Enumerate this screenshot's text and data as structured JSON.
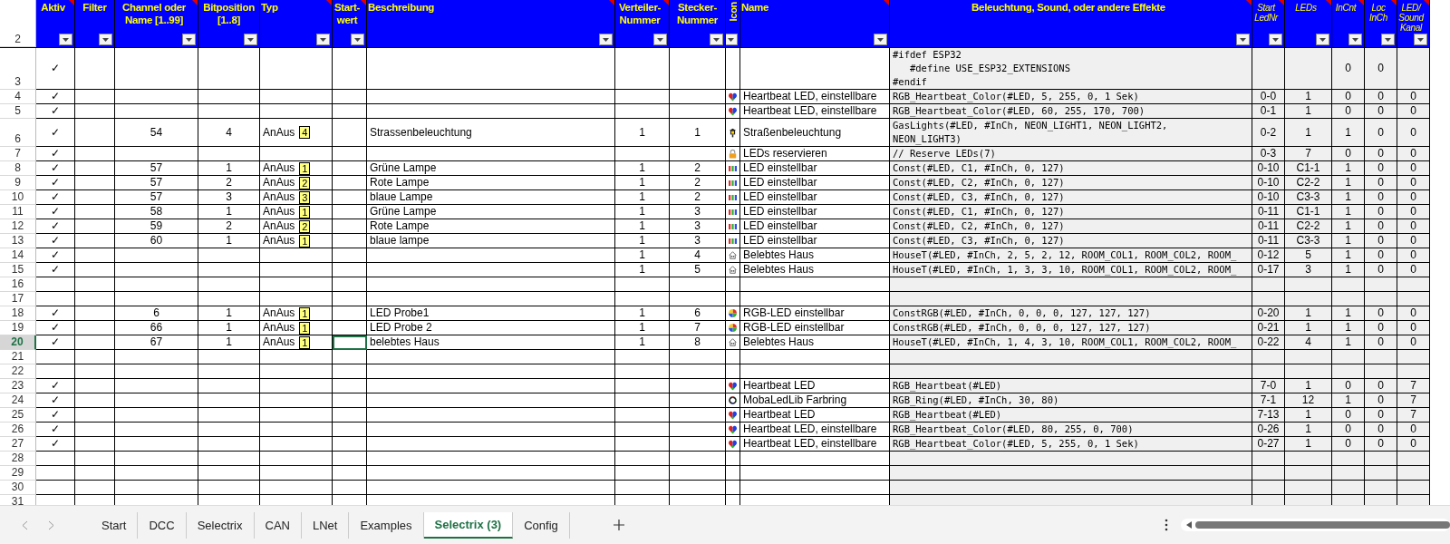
{
  "header_row": "2",
  "columns": [
    {
      "label": "Aktiv",
      "kind": "main",
      "comment": true
    },
    {
      "label": "Filter",
      "kind": "main",
      "comment": false
    },
    {
      "label": "Channel oder Name [1..99]",
      "kind": "main",
      "comment": true
    },
    {
      "label": "Bitposition [1..8]",
      "kind": "main",
      "comment": false
    },
    {
      "label": "Typ",
      "kind": "main",
      "comment": true
    },
    {
      "label": "Start-wert",
      "kind": "main",
      "comment": true
    },
    {
      "label": "Beschreibung",
      "kind": "main",
      "comment": true
    },
    {
      "label": "Verteiler-Nummer",
      "kind": "main",
      "comment": true
    },
    {
      "label": "Stecker-Nummer",
      "kind": "main",
      "comment": false
    },
    {
      "label": "Icon",
      "kind": "vertical",
      "comment": false
    },
    {
      "label": "Name",
      "kind": "main",
      "comment": true
    },
    {
      "label": "Beleuchtung, Sound, oder andere Effekte",
      "kind": "main",
      "comment": true
    },
    {
      "label": "Start LedNr",
      "kind": "small",
      "comment": true
    },
    {
      "label": "LEDs",
      "kind": "small",
      "comment": true
    },
    {
      "label": "InCnt",
      "kind": "small",
      "comment": true
    },
    {
      "label": "Loc InCh",
      "kind": "small",
      "comment": true
    },
    {
      "label": "LED/ Sound Kanal",
      "kind": "small",
      "comment": true
    }
  ],
  "rows": [
    {
      "n": "3",
      "selected": false,
      "aktiv": "✓",
      "effect": "#ifdef ESP32\n   #define USE_ESP32_EXTENSIONS\n#endif",
      "incnt": "0",
      "loc": "0"
    },
    {
      "n": "4",
      "selected": false,
      "aktiv": "✓",
      "kind": "heart",
      "name": "Heartbeat LED, einstellbare",
      "effect": "RGB_Heartbeat_Color(#LED, 5, 255, 0, 1 Sek)",
      "start": "0-0",
      "leds": "1",
      "incnt": "0",
      "loc": "0",
      "kanal": "0"
    },
    {
      "n": "5",
      "selected": false,
      "aktiv": "✓",
      "kind": "heart",
      "name": "Heartbeat LED, einstellbare",
      "effect": "RGB_Heartbeat_Color(#LED, 60, 255, 170, 700)",
      "start": "0-1",
      "leds": "1",
      "incnt": "0",
      "loc": "0",
      "kanal": "0"
    },
    {
      "n": "6",
      "selected": false,
      "aktiv": "✓",
      "channel": "54",
      "bitpos": "4",
      "typ": "AnAus",
      "badge": "4",
      "desc": "Strassenbeleuchtung",
      "verteiler": "1",
      "stecker": "1",
      "kind": "lantern",
      "name": "Straßenbeleuchtung",
      "effect": "GasLights(#LED, #InCh, NEON_LIGHT1, NEON_LIGHT2,\nNEON_LIGHT3)",
      "start": "0-2",
      "leds": "1",
      "incnt": "1",
      "loc": "0",
      "kanal": "0"
    },
    {
      "n": "7",
      "selected": false,
      "aktiv": "✓",
      "kind": "lock",
      "name": "LEDs reservieren",
      "effect": "// Reserve LEDs(7)",
      "start": "0-3",
      "leds": "7",
      "incnt": "0",
      "loc": "0",
      "kanal": "0"
    },
    {
      "n": "8",
      "selected": false,
      "aktiv": "✓",
      "channel": "57",
      "bitpos": "1",
      "typ": "AnAus",
      "badge": "1",
      "desc": "Grüne Lampe",
      "verteiler": "1",
      "stecker": "2",
      "kind": "leds",
      "name": "LED einstellbar",
      "effect": "Const(#LED, C1, #InCh, 0, 127)",
      "start": "0-10",
      "leds": "C1-1",
      "incnt": "1",
      "loc": "0",
      "kanal": "0"
    },
    {
      "n": "9",
      "selected": false,
      "aktiv": "✓",
      "channel": "57",
      "bitpos": "2",
      "typ": "AnAus",
      "badge": "2",
      "desc": "Rote Lampe",
      "verteiler": "1",
      "stecker": "2",
      "kind": "leds",
      "name": "LED einstellbar",
      "effect": "Const(#LED, C2, #InCh, 0, 127)",
      "start": "0-10",
      "leds": "C2-2",
      "incnt": "1",
      "loc": "0",
      "kanal": "0"
    },
    {
      "n": "10",
      "selected": false,
      "aktiv": "✓",
      "channel": "57",
      "bitpos": "3",
      "typ": "AnAus",
      "badge": "3",
      "desc": "blaue Lampe",
      "verteiler": "1",
      "stecker": "2",
      "kind": "leds",
      "name": "LED einstellbar",
      "effect": "Const(#LED, C3, #InCh, 0, 127)",
      "start": "0-10",
      "leds": "C3-3",
      "incnt": "1",
      "loc": "0",
      "kanal": "0"
    },
    {
      "n": "11",
      "selected": false,
      "aktiv": "✓",
      "channel": "58",
      "bitpos": "1",
      "typ": "AnAus",
      "badge": "1",
      "desc": "Grüne Lampe",
      "verteiler": "1",
      "stecker": "3",
      "kind": "leds",
      "name": "LED einstellbar",
      "effect": "Const(#LED, C1, #InCh, 0, 127)",
      "start": "0-11",
      "leds": "C1-1",
      "incnt": "1",
      "loc": "0",
      "kanal": "0"
    },
    {
      "n": "12",
      "selected": false,
      "aktiv": "✓",
      "channel": "59",
      "bitpos": "2",
      "typ": "AnAus",
      "badge": "2",
      "desc": "Rote Lampe",
      "verteiler": "1",
      "stecker": "3",
      "kind": "leds",
      "name": "LED einstellbar",
      "effect": "Const(#LED, C2, #InCh, 0, 127)",
      "start": "0-11",
      "leds": "C2-2",
      "incnt": "1",
      "loc": "0",
      "kanal": "0"
    },
    {
      "n": "13",
      "selected": false,
      "aktiv": "✓",
      "channel": "60",
      "bitpos": "1",
      "typ": "AnAus",
      "badge": "1",
      "desc": "blaue lampe",
      "verteiler": "1",
      "stecker": "3",
      "kind": "leds",
      "name": "LED einstellbar",
      "effect": "Const(#LED, C3, #InCh, 0, 127)",
      "start": "0-11",
      "leds": "C3-3",
      "incnt": "1",
      "loc": "0",
      "kanal": "0"
    },
    {
      "n": "14",
      "selected": false,
      "aktiv": "✓",
      "verteiler": "1",
      "stecker": "4",
      "kind": "house",
      "name": "Belebtes Haus",
      "effect": "HouseT(#LED, #InCh, 2, 5, 2, 12, ROOM_COL1, ROOM_COL2, ROOM_",
      "start": "0-12",
      "leds": "5",
      "incnt": "1",
      "loc": "0",
      "kanal": "0"
    },
    {
      "n": "15",
      "selected": false,
      "aktiv": "✓",
      "verteiler": "1",
      "stecker": "5",
      "kind": "house",
      "name": "Belebtes Haus",
      "effect": "HouseT(#LED, #InCh, 1, 3, 3, 10, ROOM_COL1, ROOM_COL2, ROOM_",
      "start": "0-17",
      "leds": "3",
      "incnt": "1",
      "loc": "0",
      "kanal": "0"
    },
    {
      "n": "16",
      "selected": false
    },
    {
      "n": "17",
      "selected": false
    },
    {
      "n": "18",
      "selected": false,
      "aktiv": "✓",
      "channel": "6",
      "bitpos": "1",
      "typ": "AnAus",
      "badge": "1",
      "desc": "LED Probe1",
      "verteiler": "1",
      "stecker": "6",
      "kind": "wheel",
      "name": "RGB-LED einstellbar",
      "effect": "ConstRGB(#LED, #InCh, 0, 0, 0, 127, 127, 127)",
      "start": "0-20",
      "leds": "1",
      "incnt": "1",
      "loc": "0",
      "kanal": "0"
    },
    {
      "n": "19",
      "selected": false,
      "aktiv": "✓",
      "channel": "66",
      "bitpos": "1",
      "typ": "AnAus",
      "badge": "1",
      "desc": "LED Probe 2",
      "verteiler": "1",
      "stecker": "7",
      "kind": "wheel",
      "name": "RGB-LED einstellbar",
      "effect": "ConstRGB(#LED, #InCh, 0, 0, 0, 127, 127, 127)",
      "start": "0-21",
      "leds": "1",
      "incnt": "1",
      "loc": "0",
      "kanal": "0"
    },
    {
      "n": "20",
      "selected": true,
      "aktiv": "✓",
      "channel": "67",
      "bitpos": "1",
      "typ": "AnAus",
      "badge": "1",
      "desc": "belebtes Haus",
      "verteiler": "1",
      "stecker": "8",
      "kind": "house",
      "name": "Belebtes Haus",
      "effect": "HouseT(#LED, #InCh, 1, 4, 3, 10, ROOM_COL1, ROOM_COL2, ROOM_",
      "start": "0-22",
      "leds": "4",
      "incnt": "1",
      "loc": "0",
      "kanal": "0"
    },
    {
      "n": "21",
      "selected": false
    },
    {
      "n": "22",
      "selected": false
    },
    {
      "n": "23",
      "selected": false,
      "aktiv": "✓",
      "kind": "heart",
      "name": "Heartbeat LED",
      "effect": "RGB_Heartbeat(#LED)",
      "start": "7-0",
      "leds": "1",
      "incnt": "0",
      "loc": "0",
      "kanal": "7"
    },
    {
      "n": "24",
      "selected": false,
      "aktiv": "✓",
      "kind": "ring",
      "name": "MobaLedLib Farbring",
      "effect": "RGB_Ring(#LED, #InCh, 30, 80)",
      "start": "7-1",
      "leds": "12",
      "incnt": "1",
      "loc": "0",
      "kanal": "7"
    },
    {
      "n": "25",
      "selected": false,
      "aktiv": "✓",
      "kind": "heart",
      "name": "Heartbeat LED",
      "effect": "RGB_Heartbeat(#LED)",
      "start": "7-13",
      "leds": "1",
      "incnt": "0",
      "loc": "0",
      "kanal": "7"
    },
    {
      "n": "26",
      "selected": false,
      "aktiv": "✓",
      "kind": "heart",
      "name": "Heartbeat LED, einstellbare",
      "effect": "RGB_Heartbeat_Color(#LED, 80, 255, 0, 700)",
      "start": "0-26",
      "leds": "1",
      "incnt": "0",
      "loc": "0",
      "kanal": "0"
    },
    {
      "n": "27",
      "selected": false,
      "aktiv": "✓",
      "kind": "heart",
      "name": "Heartbeat LED, einstellbare",
      "effect": "RGB_Heartbeat_Color(#LED, 5, 255, 0, 1 Sek)",
      "start": "0-27",
      "leds": "1",
      "incnt": "0",
      "loc": "0",
      "kanal": "0"
    },
    {
      "n": "28",
      "selected": false
    },
    {
      "n": "29",
      "selected": false
    },
    {
      "n": "30",
      "selected": false
    },
    {
      "n": "31",
      "selected": false
    }
  ],
  "sheet_tabs": [
    {
      "label": "Start",
      "selected": false
    },
    {
      "label": "DCC",
      "selected": false
    },
    {
      "label": "Selectrix",
      "selected": false
    },
    {
      "label": "CAN",
      "selected": false
    },
    {
      "label": "LNet",
      "selected": false
    },
    {
      "label": "Examples",
      "selected": false
    },
    {
      "label": "Selectrix (3)",
      "selected": true
    },
    {
      "label": "Config",
      "selected": false
    }
  ]
}
